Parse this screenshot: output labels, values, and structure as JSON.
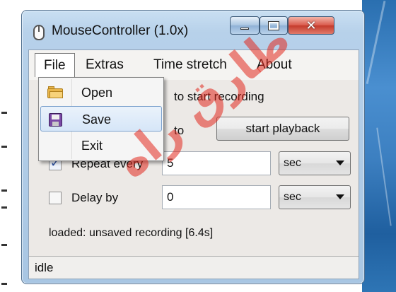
{
  "window": {
    "title": "MouseController (1.0x)",
    "controls": {
      "minimize": "minimize-icon",
      "maximize": "maximize-icon",
      "close": "close-icon"
    }
  },
  "menubar": {
    "items": [
      "File",
      "Extras",
      "Time stretch",
      "About"
    ],
    "open_menu": "File"
  },
  "file_menu": {
    "items": [
      {
        "label": "Open",
        "icon": "folder-icon"
      },
      {
        "label": "Save",
        "icon": "floppy-disk-icon",
        "highlighted": true
      },
      {
        "label": "Exit"
      }
    ]
  },
  "main": {
    "record_hint": "to start recording",
    "playback_prefix": "to",
    "playback_button": "start playback",
    "repeat": {
      "label": "Repeat every",
      "checked": true,
      "value": "5",
      "unit": "sec"
    },
    "delay": {
      "label": "Delay by",
      "checked": false,
      "value": "0",
      "unit": "sec"
    },
    "loaded_text": "loaded:  unsaved recording [6.4s]"
  },
  "status": {
    "text": "idle"
  },
  "watermark": {
    "text": "طارق راه"
  },
  "colors": {
    "client_bg": "#ece9e6",
    "frame": "#a8c6e3",
    "close_button": "#c43a2b",
    "highlight": "#d6e6f8",
    "watermark": "#e1281e"
  }
}
